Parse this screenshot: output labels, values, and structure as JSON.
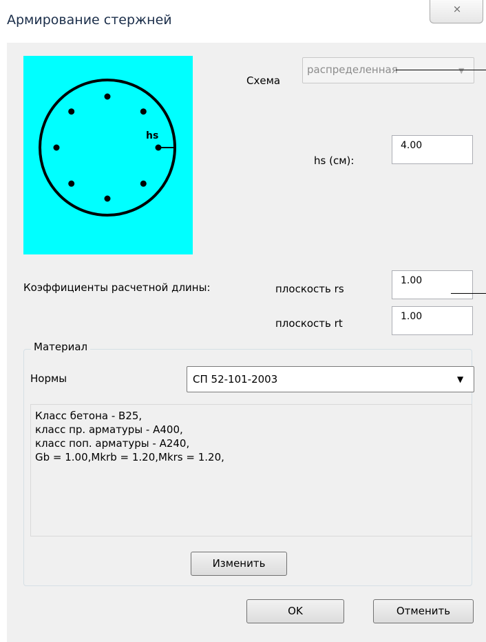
{
  "window": {
    "title": "Армирование стержней",
    "close_symbol": "⨯",
    "icon_close": "close-icon"
  },
  "diagram": {
    "hs_label": "hs",
    "background": "#00ffff",
    "bars_count": 8
  },
  "schema": {
    "label": "Схема",
    "value": "распределенная",
    "enabled": false,
    "arrow": "▼"
  },
  "hs": {
    "label": "hs (см):",
    "value": "4.00"
  },
  "coefficients": {
    "label": "Коэффициенты расчетной длины:",
    "rs_label": "плоскость rs",
    "rs_value": "1.00",
    "rt_label": "плоскость rt",
    "rt_value": "1.00"
  },
  "material": {
    "group_title": "Материал",
    "norms_label": "Нормы",
    "norms_value": "СП 52-101-2003",
    "arrow": "▼",
    "description": "Класс бетона - В25,\nкласс пр. арматуры - А400,\nкласс поп. арматуры - А240,\nGb = 1.00,Mkrb = 1.20,Mkrs = 1.20,",
    "change_button": "Изменить"
  },
  "buttons": {
    "ok": "OK",
    "cancel": "Отменить"
  }
}
